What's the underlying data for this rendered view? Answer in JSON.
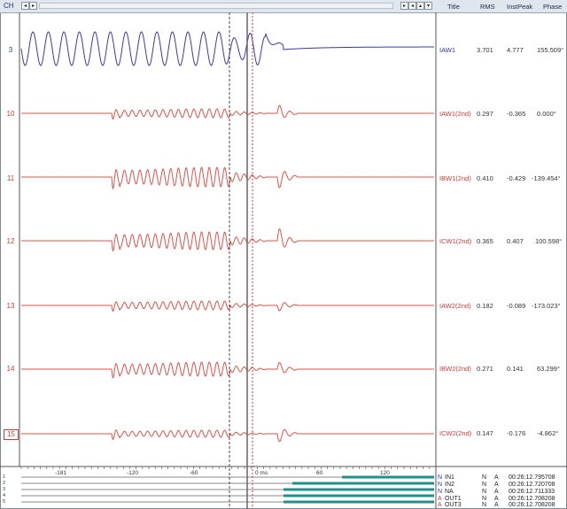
{
  "header": {
    "channel_label": "CH",
    "scroll_left": "◂",
    "scroll_right": "▸",
    "nav_buttons": [
      "▸",
      "◂",
      "▴",
      "▾"
    ],
    "columns": [
      "Title",
      "RMS",
      "InstPeak",
      "Phase"
    ]
  },
  "channels": [
    {
      "num": "3",
      "title": "IAW1",
      "rms": "3.701",
      "peak": "4.777",
      "phase": "155.509°"
    },
    {
      "num": "10",
      "title": "IAW1(2nd)",
      "rms": "0.297",
      "peak": "-0.365",
      "phase": "0.000°"
    },
    {
      "num": "11",
      "title": "IBW1(2nd)",
      "rms": "0.410",
      "peak": "-0.429",
      "phase": "-139.454°"
    },
    {
      "num": "12",
      "title": "ICW1(2nd)",
      "rms": "0.365",
      "peak": "0.407",
      "phase": "100.598°"
    },
    {
      "num": "13",
      "title": "IAW2(2nd)",
      "rms": "0.182",
      "peak": "-0.089",
      "phase": "-173.023°"
    },
    {
      "num": "14",
      "title": "IBW2(2nd)",
      "rms": "0.271",
      "peak": "0.141",
      "phase": "63.299°"
    },
    {
      "num": "15",
      "title": "ICW2(2nd)",
      "rms": "0.147",
      "peak": "-0.176",
      "phase": "-4.862°"
    }
  ],
  "time_axis": {
    "ticks": [
      "-181",
      "-120",
      "-60",
      "0 ms",
      "60",
      "120"
    ]
  },
  "digital_labels": [
    "1",
    "2",
    "3",
    "4",
    "5"
  ],
  "events": [
    {
      "type": "N",
      "name": "IN1",
      "f1": "N",
      "f2": "A",
      "time": "00:26:12.795708"
    },
    {
      "type": "N",
      "name": "IN2",
      "f1": "N",
      "f2": "A",
      "time": "00:26:12.720708"
    },
    {
      "type": "N",
      "name": "NA",
      "f1": "N",
      "f2": "A",
      "time": "00:26:12.711333"
    },
    {
      "type": "A",
      "name": "OUT1",
      "f1": "N",
      "f2": "A",
      "time": "00:26:12.708208"
    },
    {
      "type": "A",
      "name": "OUT3",
      "f1": "N",
      "f2": "A",
      "time": "00:26:12.708208"
    }
  ],
  "colors": {
    "blue_trace": "#3a3aa8",
    "red_trace": "#e0524a",
    "digital_on": "#1f8f8a",
    "cursor": "#555555"
  }
}
